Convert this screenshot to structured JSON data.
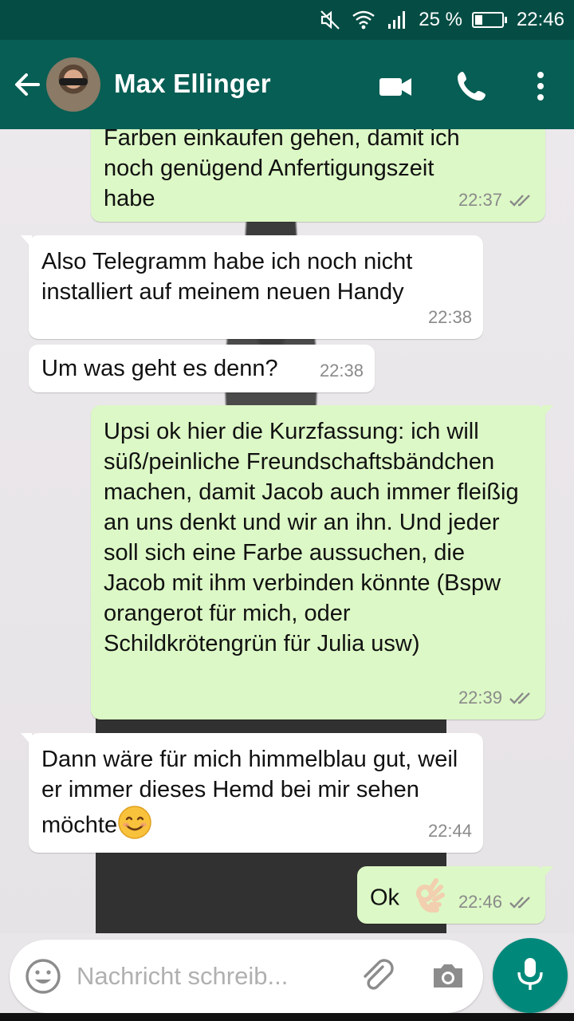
{
  "status_bar": {
    "battery": "25 %",
    "time": "22:46",
    "icons": [
      "mute-icon",
      "wifi-icon",
      "signal-icon",
      "battery-icon"
    ]
  },
  "header": {
    "contact_name": "Max Ellinger",
    "icons": [
      "back-arrow-icon",
      "video-call-icon",
      "phone-icon",
      "more-vert-icon"
    ]
  },
  "messages": [
    {
      "direction": "out",
      "text": "Farben einkaufen gehen, damit ich noch genügend Anfertigungszeit habe",
      "time": "22:37",
      "status": "read"
    },
    {
      "direction": "in",
      "text": "Also Telegramm habe ich noch nicht installiert auf meinem neuen Handy",
      "time": "22:38"
    },
    {
      "direction": "in",
      "text": "Um was geht es denn?",
      "time": "22:38"
    },
    {
      "direction": "out",
      "text": "Upsi ok hier die Kurzfassung: ich will süß/peinliche Freundschaftsbändchen machen, damit Jacob auch immer fleißig an uns denkt und wir an ihn. Und jeder soll sich eine Farbe aussuchen, die Jacob mit ihm verbinden könnte (Bspw orangerot für mich, oder Schildkrötengrün für Julia usw)",
      "time": "22:39",
      "status": "read"
    },
    {
      "direction": "in",
      "text": "Dann wäre für mich himmelblau gut, weil er immer dieses Hemd bei mir sehen möchte",
      "emoji": "smiling-face-emoji",
      "time": "22:44"
    },
    {
      "direction": "out",
      "text": "Ok",
      "emoji": "ok-hand-emoji",
      "time": "22:46",
      "status": "read"
    }
  ],
  "input": {
    "placeholder": "Nachricht schreib...",
    "value": ""
  },
  "colors": {
    "status_bar": "#054d44",
    "app_bar": "#075e54",
    "outgoing_bubble": "#dcf8c6",
    "incoming_bubble": "#ffffff",
    "mic_button": "#00897b",
    "read_ticks": "#8a8a8a"
  }
}
